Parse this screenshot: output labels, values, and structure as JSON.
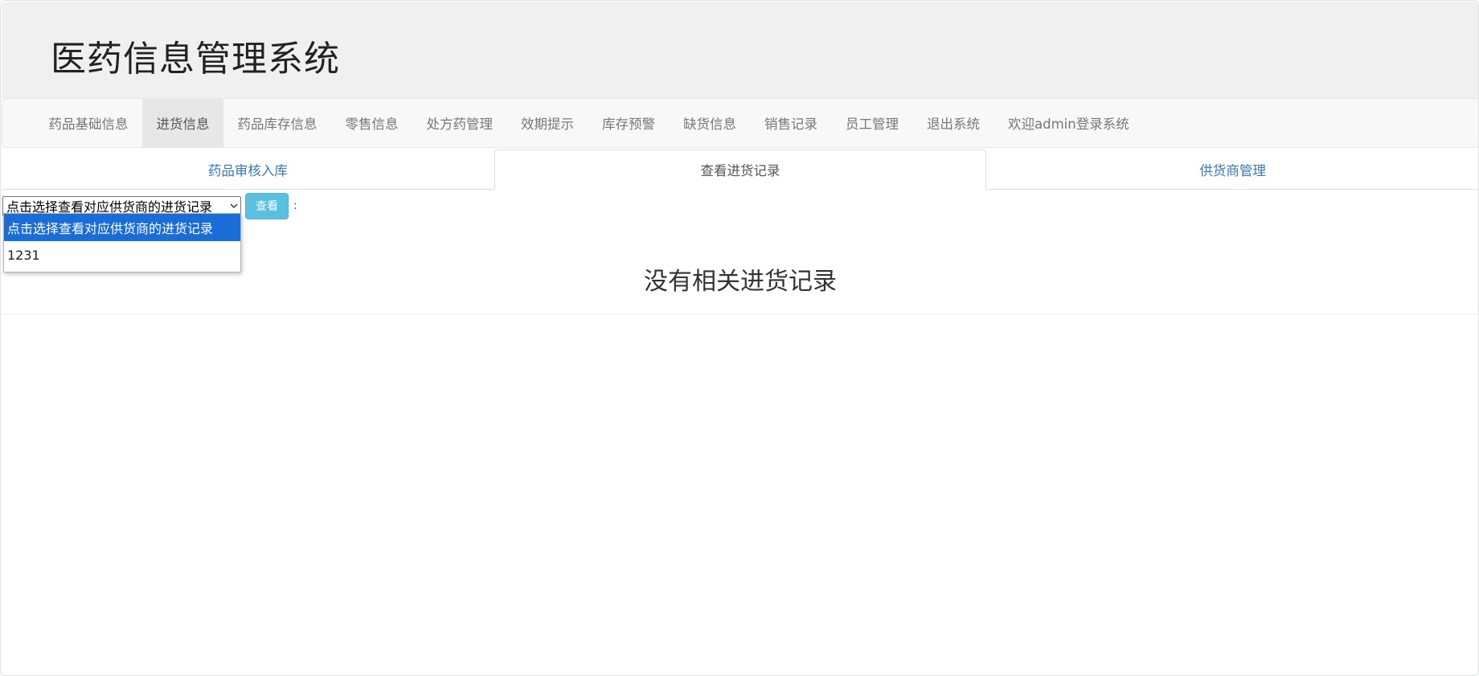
{
  "app": {
    "title": "医药信息管理系统"
  },
  "navbar": {
    "items": [
      {
        "label": "药品基础信息"
      },
      {
        "label": "进货信息",
        "active": true
      },
      {
        "label": "药品库存信息"
      },
      {
        "label": "零售信息"
      },
      {
        "label": "处方药管理"
      },
      {
        "label": "效期提示"
      },
      {
        "label": "库存预警"
      },
      {
        "label": "缺货信息"
      },
      {
        "label": "销售记录"
      },
      {
        "label": "员工管理"
      },
      {
        "label": "退出系统"
      },
      {
        "label": "欢迎admin登录系统"
      }
    ]
  },
  "tabs": [
    {
      "label": "药品审核入库"
    },
    {
      "label": "查看进货记录",
      "active": true
    },
    {
      "label": "供货商管理"
    }
  ],
  "filter": {
    "select_value": "点击选择查看对应供货商的进货记录",
    "options": [
      "点击选择查看对应供货商的进货记录",
      "1231"
    ],
    "view_label": "查看",
    "colon": ":"
  },
  "main": {
    "empty_message": "没有相关进货记录"
  },
  "colors": {
    "header_bg": "#f0f0f0",
    "navbar_bg": "#f8f8f8",
    "nav_active_bg": "#e7e7e7",
    "tab_link": "#337ab7",
    "info_button": "#5bc0de",
    "selected_option": "#1a6dd6"
  },
  "icons": {
    "select_chevron": "chevron-down-icon"
  }
}
